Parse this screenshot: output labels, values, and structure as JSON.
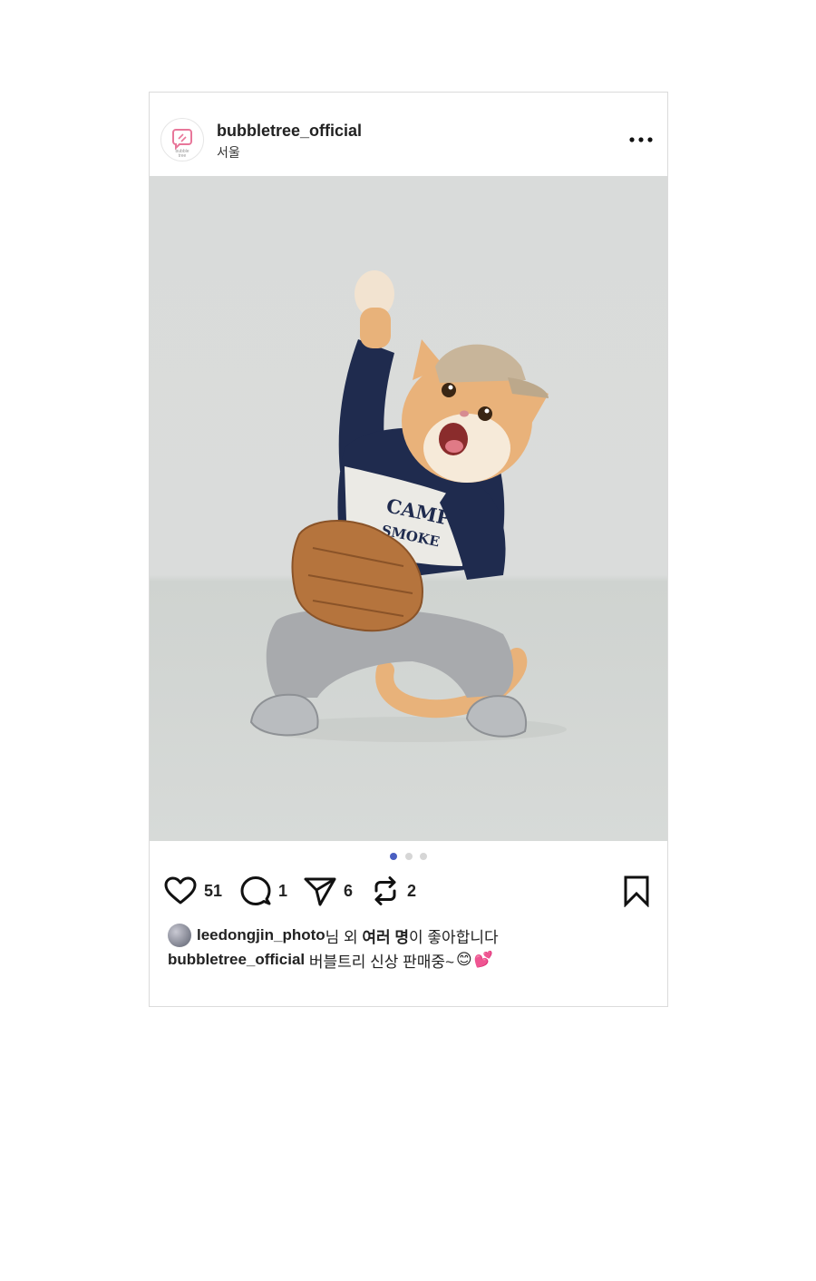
{
  "post": {
    "username": "bubbletree_official",
    "location": "서울",
    "logo_text": "bubble tree"
  },
  "actions": {
    "likes": "51",
    "comments": "1",
    "shares": "6",
    "reposts": "2"
  },
  "carousel": {
    "total": 3,
    "active": 1
  },
  "liked_by": {
    "user": "leedongjin_photo",
    "text_mid": "님 외 ",
    "bold_text": "여러 명",
    "text_end": "이 좋아합니다"
  },
  "caption": {
    "username": "bubbletree_official",
    "text": " 버블트리 신상 판매중~",
    "emoji1": "😊",
    "emoji2": "💕"
  },
  "photo": {
    "subject": "cat-wearing-camp-smoke-sweatshirt",
    "shirt_text": "CAMP SMOKE"
  },
  "colors": {
    "active_dot": "#4a5fc1",
    "inactive_dot": "#d6d6d6",
    "logo_pink": "#e8779a"
  }
}
